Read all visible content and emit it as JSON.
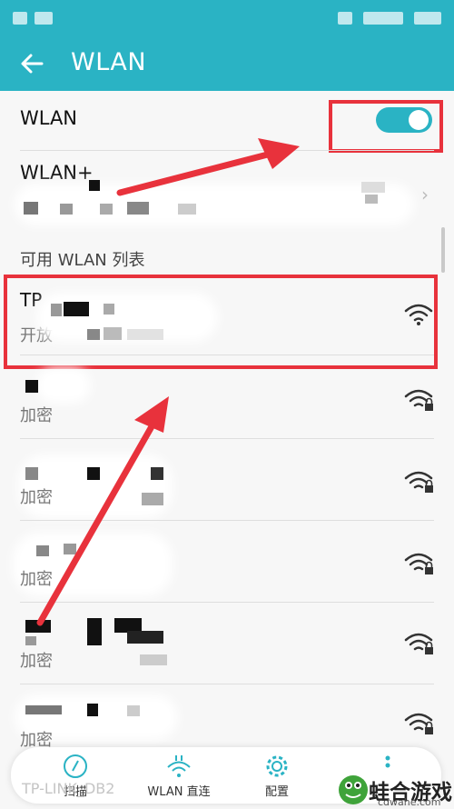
{
  "header": {
    "title": "WLAN",
    "back_icon": "back-arrow-icon"
  },
  "wlan_toggle": {
    "label": "WLAN",
    "state": "on"
  },
  "wlan_plus": {
    "label": "WLAN+"
  },
  "section_header": "可用 WLAN 列表",
  "networks": [
    {
      "name": "TP",
      "status": "开放",
      "secured": false
    },
    {
      "name": "",
      "status": "加密",
      "secured": true
    },
    {
      "name": "",
      "status": "加密",
      "secured": true
    },
    {
      "name": "",
      "status": "加密",
      "secured": true
    },
    {
      "name": "",
      "status": "加密",
      "secured": true
    },
    {
      "name": "",
      "status": "加密",
      "secured": true
    }
  ],
  "bottom_tabs": [
    {
      "label": "扫描",
      "icon": "refresh-icon"
    },
    {
      "label": "WLAN 直连",
      "icon": "wifi-direct-icon"
    },
    {
      "label": "配置",
      "icon": "gear-icon"
    },
    {
      "label": "",
      "icon": "more-icon"
    }
  ],
  "bottom_ghost_text": "TP-LINK_DB2",
  "watermark": {
    "brand": "蛙合游戏",
    "url": "cdwahe.com"
  },
  "colors": {
    "accent": "#2ab3c4",
    "highlight": "#e8323c"
  }
}
